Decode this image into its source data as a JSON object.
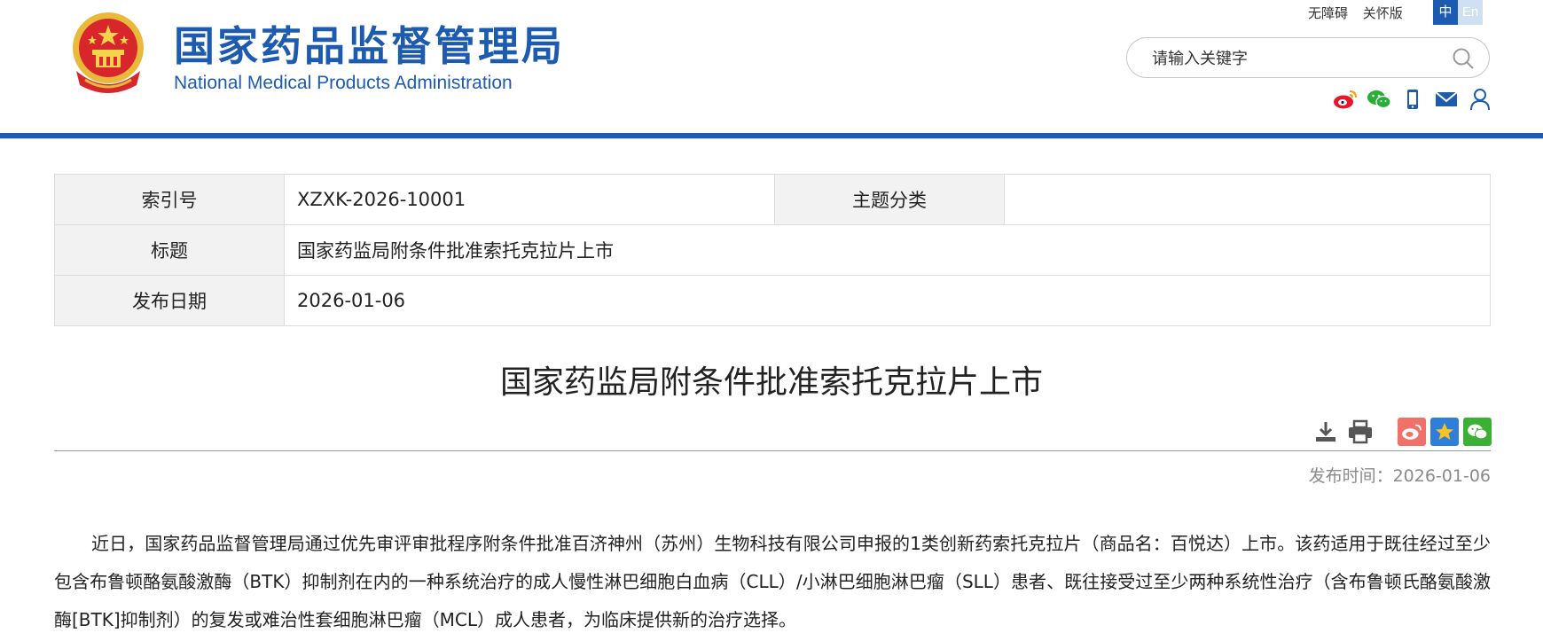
{
  "header": {
    "brand_cn": "国家药品监督管理局",
    "brand_en": "National Medical Products Administration",
    "accessibility_label": "无障碍",
    "care_label": "关怀版",
    "lang_zh": "中",
    "lang_en": "En",
    "search_placeholder": "请输入关键字",
    "social_icons": [
      "weibo-icon",
      "wechat-icon",
      "mobile-icon",
      "mail-icon",
      "user-icon"
    ],
    "brand_color": "#1d5bb0"
  },
  "info": {
    "index_label": "索引号",
    "index_value": "XZXK-2026-10001",
    "category_label": "主题分类",
    "category_value": "",
    "title_label": "标题",
    "title_value": "国家药监局附条件批准索托克拉片上市",
    "date_label": "发布日期",
    "date_value": "2026-01-06"
  },
  "article": {
    "title": "国家药监局附条件批准索托克拉片上市",
    "publish_time": "发布时间：2026-01-06",
    "tool_icons": [
      "download-icon",
      "print-icon"
    ],
    "share_icons": [
      "weibo-share-icon",
      "favorite-share-icon",
      "wechat-share-icon"
    ],
    "body": "近日，国家药品监督管理局通过优先审评审批程序附条件批准百济神州（苏州）生物科技有限公司申报的1类创新药索托克拉片（商品名：百悦达）上市。该药适用于既往经过至少包含布鲁顿酪氨酸激酶（BTK）抑制剂在内的一种系统治疗的成人慢性淋巴细胞白血病（CLL）/小淋巴细胞淋巴瘤（SLL）患者、既往接受过至少两种系统性治疗（含布鲁顿氏酪氨酸激酶[BTK]抑制剂）的复发或难治性套细胞淋巴瘤（MCL）成人患者，为临床提供新的治疗选择。"
  }
}
